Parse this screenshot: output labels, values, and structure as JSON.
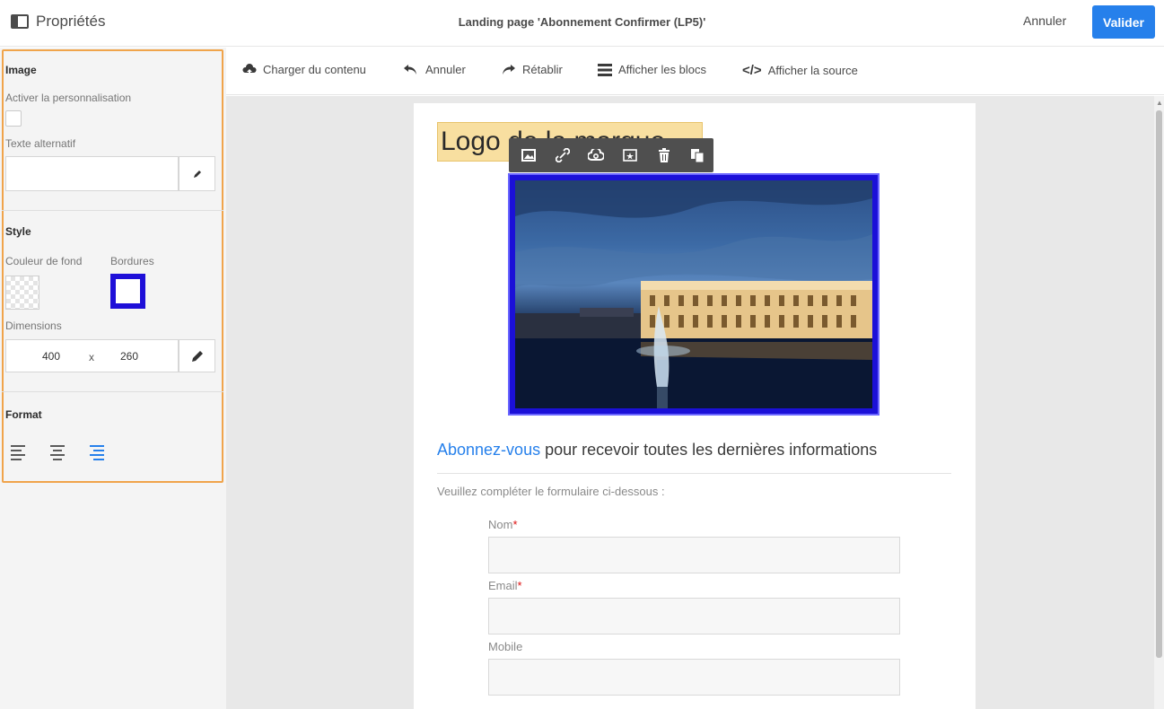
{
  "header": {
    "panel_title": "Propriétés",
    "page_title": "Landing page 'Abonnement Confirmer (LP5)'",
    "cancel_label": "Annuler",
    "validate_label": "Valider",
    "accent_color": "#2680eb"
  },
  "panel": {
    "image_section": {
      "title": "Image",
      "personalization_label": "Activer la personnalisation",
      "personalization_checked": false,
      "alt_text_label": "Texte alternatif",
      "alt_text_value": ""
    },
    "style_section": {
      "title": "Style",
      "bg_color_label": "Couleur de fond",
      "borders_label": "Bordures",
      "border_color": "#1e0fd8",
      "dimensions_label": "Dimensions",
      "width": "400",
      "separator": "x",
      "height": "260"
    },
    "format_section": {
      "title": "Format",
      "alignments": [
        "align-left",
        "align-center",
        "align-right"
      ],
      "active_alignment": "align-right"
    }
  },
  "toolbar": {
    "load_content": "Charger du contenu",
    "undo": "Annuler",
    "redo": "Rétablir",
    "show_blocks": "Afficher les blocs",
    "show_source": "Afficher la source"
  },
  "content": {
    "logo_text": "Logo de la marque",
    "subscribe_link": "Abonnez-vous",
    "subscribe_rest": " pour recevoir toutes les dernières informations",
    "form_intro": "Veuillez compléter le formulaire ci-dessous :",
    "fields": [
      {
        "label": "Nom",
        "required": true
      },
      {
        "label": "Email",
        "required": true
      },
      {
        "label": "Mobile",
        "required": false
      }
    ],
    "required_mark": "*"
  },
  "image_toolbar": [
    "image-icon",
    "link-icon",
    "creative-cloud-icon",
    "personalize-icon",
    "trash-icon",
    "duplicate-icon"
  ]
}
